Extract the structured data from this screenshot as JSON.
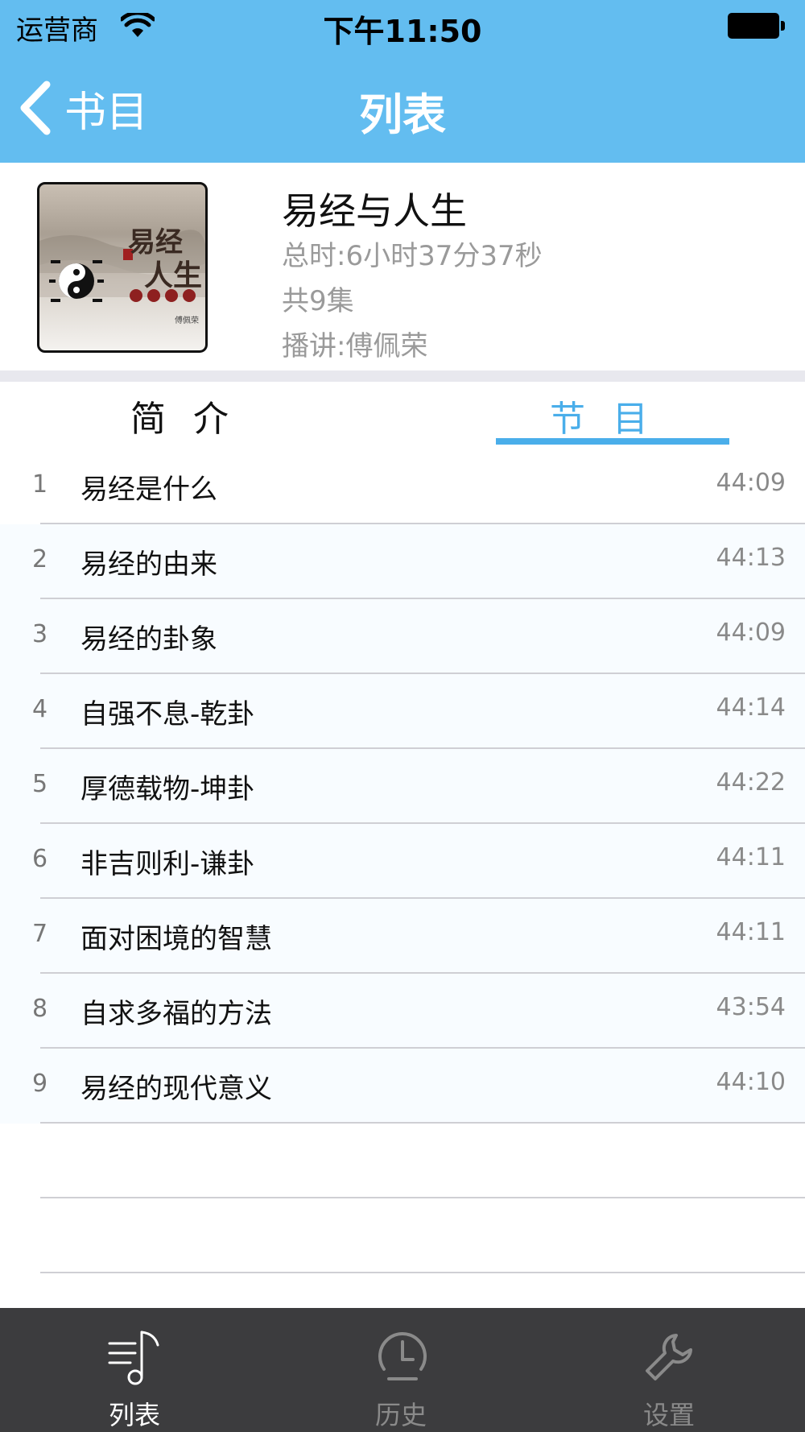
{
  "status_bar": {
    "carrier": "运营商",
    "time": "下午11:50"
  },
  "nav": {
    "back_label": "书目",
    "title": "列表"
  },
  "book": {
    "title": "易经与人生",
    "total_time": "总时:6小时37分37秒",
    "episode_count": "共9集",
    "narrator": "播讲:傅佩荣",
    "cover_title_1": "易经",
    "cover_title_2": "人生"
  },
  "tabs": {
    "intro": "简介",
    "episodes": "节目",
    "active": "episodes"
  },
  "episodes": [
    {
      "num": "1",
      "title": "易经是什么",
      "duration": "44:09"
    },
    {
      "num": "2",
      "title": "易经的由来",
      "duration": "44:13"
    },
    {
      "num": "3",
      "title": "易经的卦象",
      "duration": "44:09"
    },
    {
      "num": "4",
      "title": "自强不息-乾卦",
      "duration": "44:14"
    },
    {
      "num": "5",
      "title": "厚德载物-坤卦",
      "duration": "44:22"
    },
    {
      "num": "6",
      "title": "非吉则利-谦卦",
      "duration": "44:11"
    },
    {
      "num": "7",
      "title": "面对困境的智慧",
      "duration": "44:11"
    },
    {
      "num": "8",
      "title": "自求多福的方法",
      "duration": "43:54"
    },
    {
      "num": "9",
      "title": "易经的现代意义",
      "duration": "44:10"
    }
  ],
  "tabbar": {
    "list": "列表",
    "history": "历史",
    "settings": "设置",
    "active": "list"
  },
  "colors": {
    "nav_blue": "#63bdf0",
    "accent_blue": "#4aaeea",
    "tabbar_bg": "#3c3c3e"
  },
  "icons": {
    "back": "chevron-left-icon",
    "wifi": "wifi-icon",
    "battery": "battery-icon",
    "list_tab": "music-list-icon",
    "history_tab": "clock-icon",
    "settings_tab": "wrench-icon"
  }
}
